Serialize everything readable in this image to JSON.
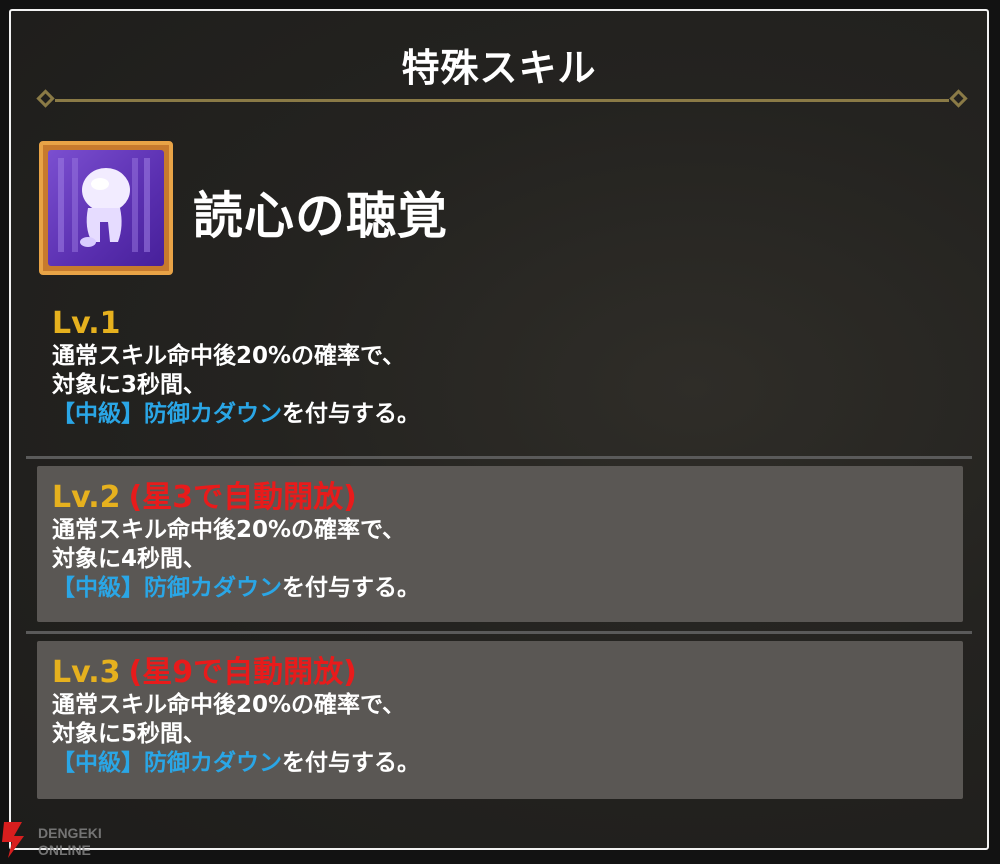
{
  "panel": {
    "title": "特殊スキル"
  },
  "skill": {
    "name": "読心の聴覚",
    "icon": "listening-ghost-icon"
  },
  "levels": [
    {
      "level": "Lv.1",
      "unlock": "",
      "line1": "通常スキル命中後20%の確率で、",
      "line2": "対象に3秒間、",
      "tag": "【中級】防御カダウン",
      "suffix": "を付与する。"
    },
    {
      "level": "Lv.2",
      "unlock": "(星3で自動開放)",
      "line1": "通常スキル命中後20%の確率で、",
      "line2": "対象に4秒間、",
      "tag": "【中級】防御カダウン",
      "suffix": "を付与する。"
    },
    {
      "level": "Lv.3",
      "unlock": "(星9で自動開放)",
      "line1": "通常スキル命中後20%の確率で、",
      "line2": "対象に5秒間、",
      "tag": "【中級】防御カダウン",
      "suffix": "を付与する。"
    }
  ],
  "watermark": {
    "line1": "DENGEKI",
    "line2": "ONLINE"
  },
  "colors": {
    "level_gold": "#e6b11e",
    "unlock_red": "#e81b1b",
    "tag_blue": "#2aa6e6",
    "frame_gold": "#8a7a46"
  }
}
